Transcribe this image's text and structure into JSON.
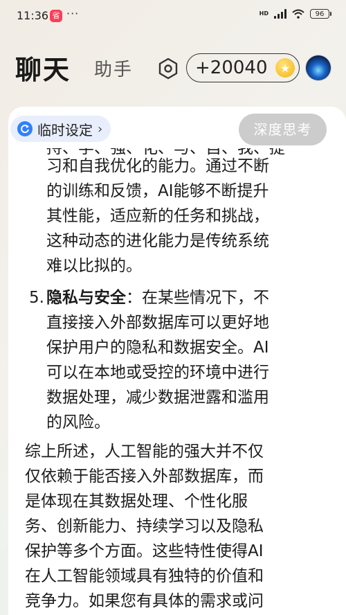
{
  "status_bar": {
    "time": "11:36",
    "app_badge": "省",
    "more": "···",
    "hd": "HD",
    "battery": "96"
  },
  "header": {
    "tab_active": "聊天",
    "tab_inactive": "助手",
    "points": "+20040"
  },
  "toolbar": {
    "temp_setting_label": "临时设定",
    "chevron": "›",
    "deep_think_label": "深度思考"
  },
  "message": {
    "cut_line": "持、学、强、化、与、自、我、提",
    "item4_lines": [
      "习和自我优化的能力。通过不断",
      "的训练和反馈，AI能够不断提升",
      "其性能，适应新的任务和挑战，",
      "这种动态的进化能力是传统系统",
      "难以比拟的。"
    ],
    "item5": {
      "number": "5.",
      "title": "隐私与安全",
      "first_line_rest": "：在某些情况下，不",
      "lines": [
        "直接接入外部数据库可以更好地",
        "保护用户的隐私和数据安全。AI",
        "可以在本地或受控的环境中进行",
        "数据处理，减少数据泄露和滥用",
        "的风险。"
      ]
    },
    "summary_lines": [
      "综上所述，人工智能的强大并不仅",
      "仅依赖于能否接入外部数据库，而",
      "是体现在其数据处理、个性化服",
      "务、创新能力、持续学习以及隐私",
      "保护等多个方面。这些特性使得AI",
      "在人工智能领域具有独特的价值和",
      "竞争力。如果您有具体的需求或问"
    ]
  }
}
